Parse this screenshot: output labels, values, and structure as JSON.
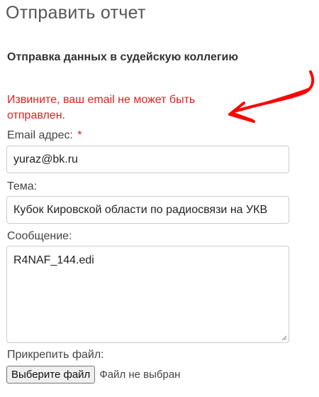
{
  "page": {
    "title": "Отправить отчет",
    "subtitle": "Отправка данных в судейскую коллегию"
  },
  "error": {
    "message": "Извините, ваш email не может быть отправлен.",
    "color": "#e0201c"
  },
  "form": {
    "email": {
      "label": "Email адрес:",
      "required_mark": "*",
      "value": "yuraz@bk.ru"
    },
    "subject": {
      "label": "Тема:",
      "value": "Кубок Кировской области по радиосвязи на УКВ"
    },
    "message": {
      "label": "Сообщение:",
      "value": "R4NAF_144.edi"
    },
    "attachment": {
      "label": "Прикрепить файл:",
      "button_label": "Выберите файл",
      "status": "Файл не выбран"
    }
  },
  "annotation": {
    "arrow_color": "#ff0000"
  }
}
